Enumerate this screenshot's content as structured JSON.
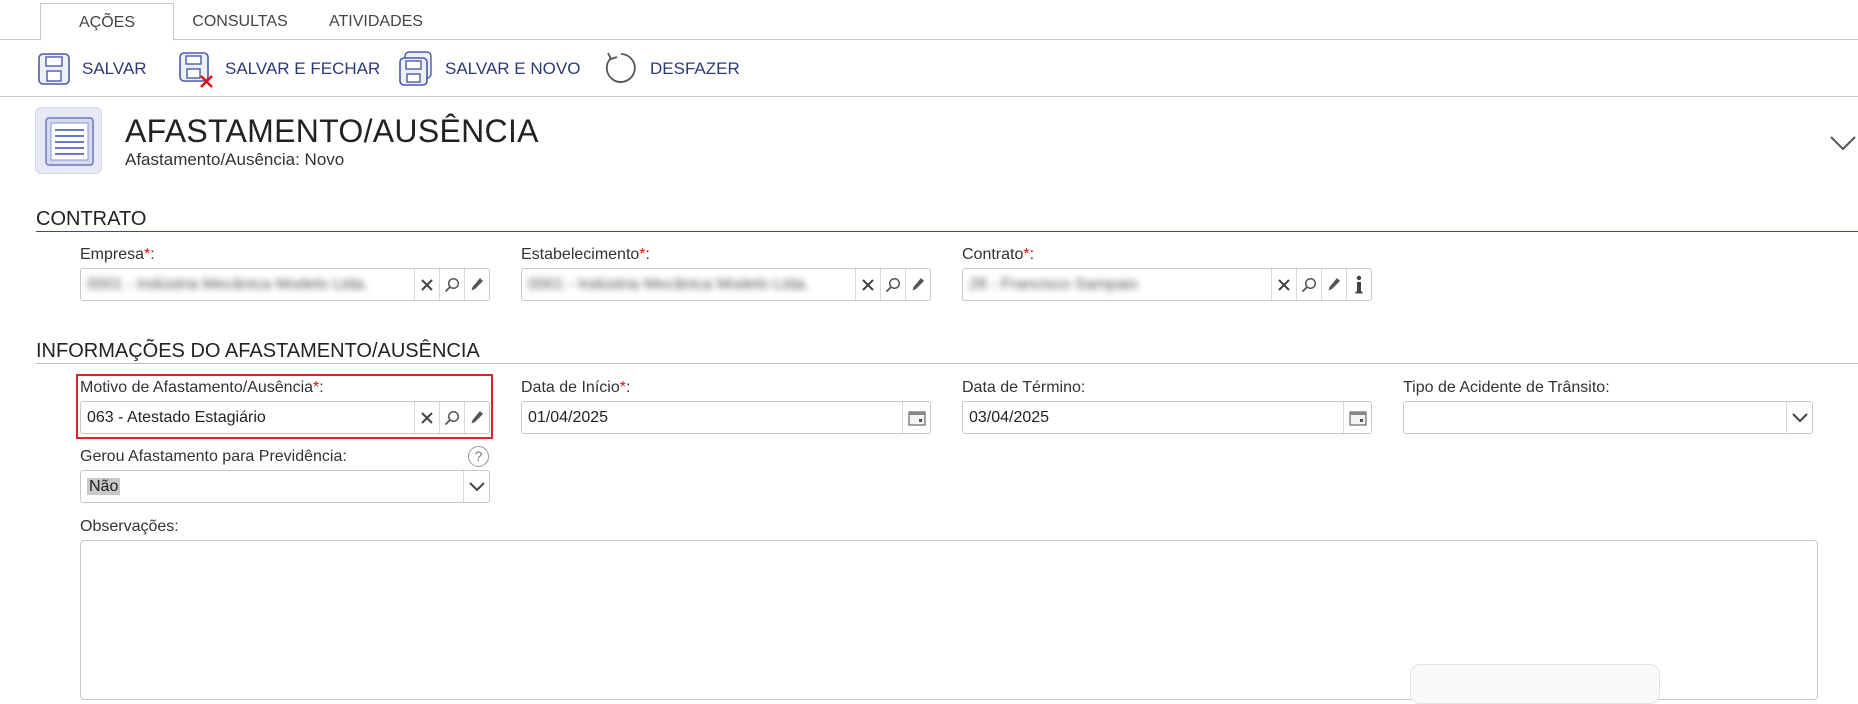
{
  "tabs": [
    {
      "label": "AÇÕES",
      "active": true
    },
    {
      "label": "CONSULTAS",
      "active": false
    },
    {
      "label": "ATIVIDADES",
      "active": false
    }
  ],
  "toolbar": {
    "save": "SALVAR",
    "save_close": "SALVAR E FECHAR",
    "save_new": "SALVAR E NOVO",
    "undo": "DESFAZER"
  },
  "header": {
    "title": "AFASTAMENTO/AUSÊNCIA",
    "subtitle": "Afastamento/Ausência: Novo"
  },
  "sections": {
    "contract": "CONTRATO",
    "info": "INFORMAÇÕES DO AFASTAMENTO/AUSÊNCIA"
  },
  "fields": {
    "empresa": {
      "label": "Empresa",
      "value": "0001 - Indústria Mecânica Modelo Ltda."
    },
    "estabelecimento": {
      "label": "Estabelecimento",
      "value": "0001 - Indústria Mecânica Modelo Ltda."
    },
    "contrato": {
      "label": "Contrato",
      "value": "28 - Francisco Sampaio"
    },
    "motivo": {
      "label": "Motivo de Afastamento/Ausência",
      "value": "063 - Atestado Estagiário"
    },
    "data_inicio": {
      "label": "Data de Início",
      "value": "01/04/2025"
    },
    "data_termino": {
      "label": "Data de Término",
      "value": "03/04/2025"
    },
    "tipo_acidente": {
      "label": "Tipo de Acidente de Trânsito",
      "value": ""
    },
    "gerou_previdencia": {
      "label": "Gerou Afastamento para Previdência:",
      "value": "Não"
    },
    "observacoes": {
      "label": "Observações:",
      "value": ""
    }
  },
  "required_marker": "*",
  "label_suffix": ":",
  "help_glyph": "?",
  "colors": {
    "accent": "#2a3a7a",
    "section_line": "#3a4a9a",
    "required": "#e01010",
    "highlight": "#d9262c",
    "clear_x": "#e01010"
  }
}
